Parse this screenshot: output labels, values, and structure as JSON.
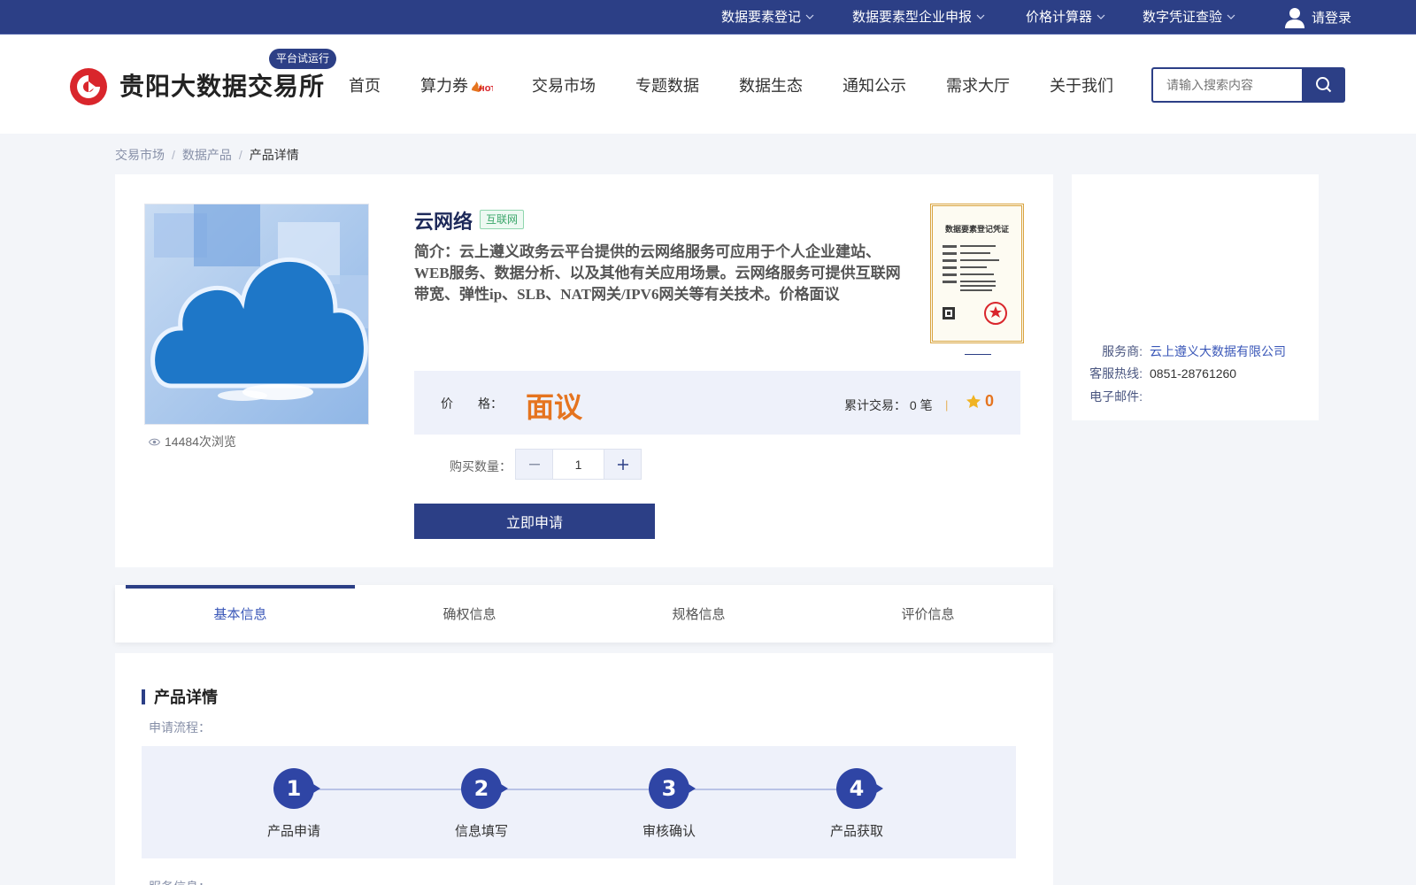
{
  "topbar": {
    "items": [
      {
        "label": "数据要素登记"
      },
      {
        "label": "数据要素型企业申报"
      },
      {
        "label": "价格计算器"
      },
      {
        "label": "数字凭证查验"
      }
    ],
    "login_label": "请登录"
  },
  "header": {
    "logo_text": "贵阳大数据交易所",
    "badge": "平台试运行",
    "nav": [
      {
        "label": "首页"
      },
      {
        "label": "算力券"
      },
      {
        "label": "交易市场"
      },
      {
        "label": "专题数据"
      },
      {
        "label": "数据生态"
      },
      {
        "label": "通知公示"
      },
      {
        "label": "需求大厅"
      },
      {
        "label": "关于我们"
      }
    ],
    "hot_label": "HOT",
    "search_placeholder": "请输入搜索内容"
  },
  "breadcrumb": [
    "交易市场",
    "数据产品",
    "产品详情"
  ],
  "product": {
    "title": "云网络",
    "tag": "互联网",
    "description": "简介：云上遵义政务云平台提供的云网络服务可应用于个人企业建站、WEB服务、数据分析、以及其他有关应用场景。云网络服务可提供互联网带宽、弹性ip、SLB、NAT网关/IPV6网关等有关技术。价格面议",
    "views": "14484次浏览",
    "cert_title": "数据要素登记凭证",
    "price_label": "价　　格：",
    "price_value": "面议",
    "trades": "累计交易：  0 笔",
    "trades_sep": "|",
    "rating": "0",
    "qty_label": "购买数量：",
    "qty_value": "1",
    "apply_label": "立即申请"
  },
  "provider": {
    "provider_key": "服务商:",
    "provider_value": "云上遵义大数据有限公司",
    "hotline_key": "客服热线:",
    "hotline_value": "0851-28761260",
    "email_key": "电子邮件:",
    "email_value": ""
  },
  "tabs": [
    {
      "label": "基本信息"
    },
    {
      "label": "确权信息"
    },
    {
      "label": "规格信息"
    },
    {
      "label": "评价信息"
    }
  ],
  "details": {
    "section_title": "产品详情",
    "flow_label": "申请流程：",
    "steps": [
      {
        "num": "1",
        "label": "产品申请"
      },
      {
        "num": "2",
        "label": "信息填写"
      },
      {
        "num": "3",
        "label": "审核确认"
      },
      {
        "num": "4",
        "label": "产品获取"
      }
    ],
    "service_label": "服务信息："
  },
  "colors": {
    "brand": "#2c3f86",
    "price": "#e5741f",
    "accent_link": "#3a57b8"
  }
}
